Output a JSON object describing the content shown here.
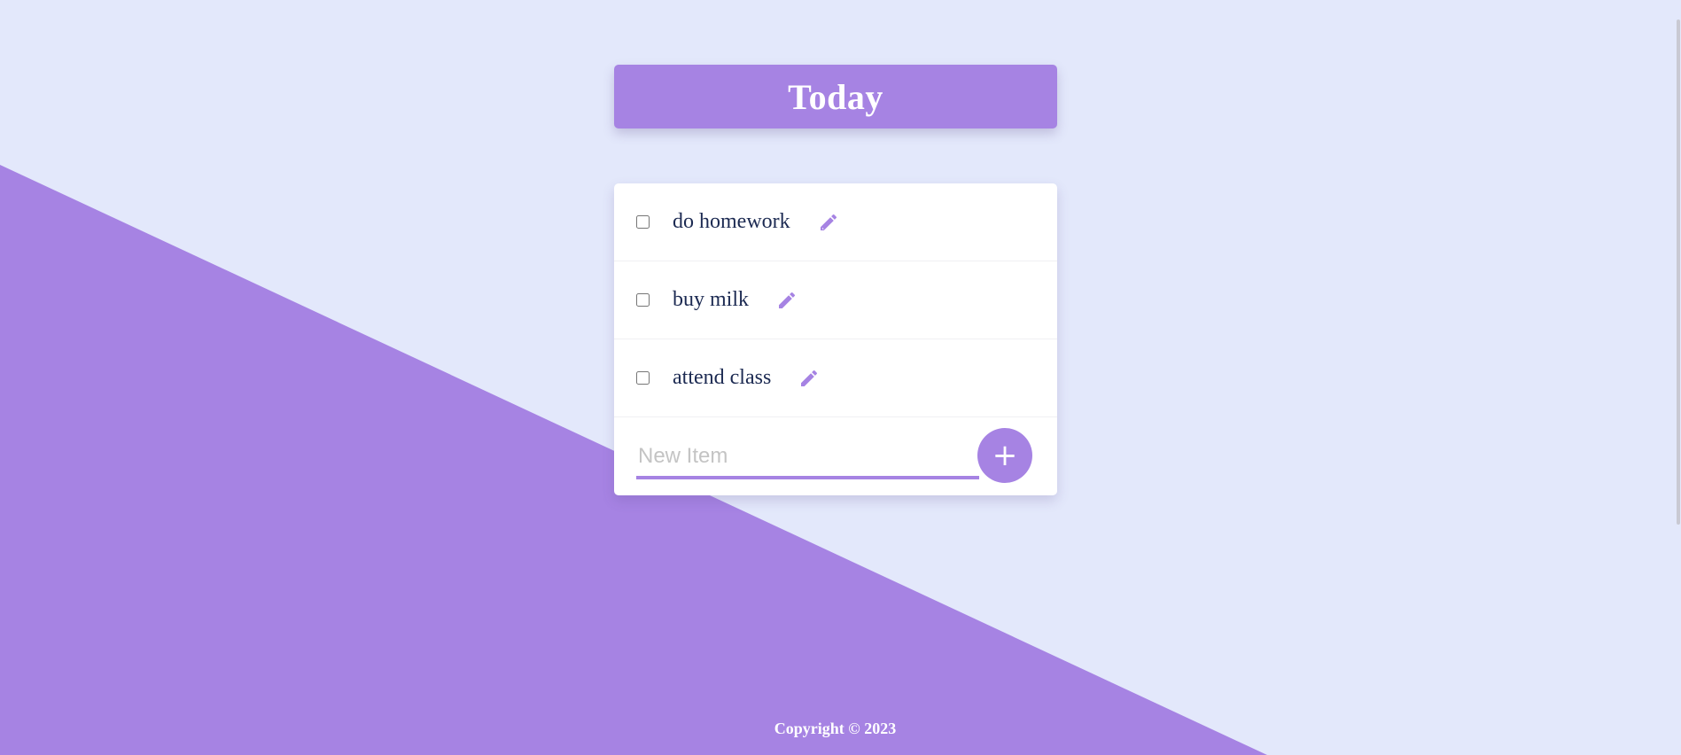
{
  "app": {
    "heading": "Today",
    "accent_color": "#a683e3",
    "background_color": "#e3e8fb"
  },
  "todo": {
    "items": [
      {
        "label": "do homework",
        "checked": false,
        "edit_icon": "pencil-icon"
      },
      {
        "label": "buy milk",
        "checked": false,
        "edit_icon": "pencil-icon"
      },
      {
        "label": "attend class",
        "checked": false,
        "edit_icon": "pencil-icon"
      }
    ],
    "new_item": {
      "value": "",
      "placeholder": "New Item"
    },
    "add_button_label": "+"
  },
  "footer": {
    "copyright": "Copyright © 2023"
  }
}
